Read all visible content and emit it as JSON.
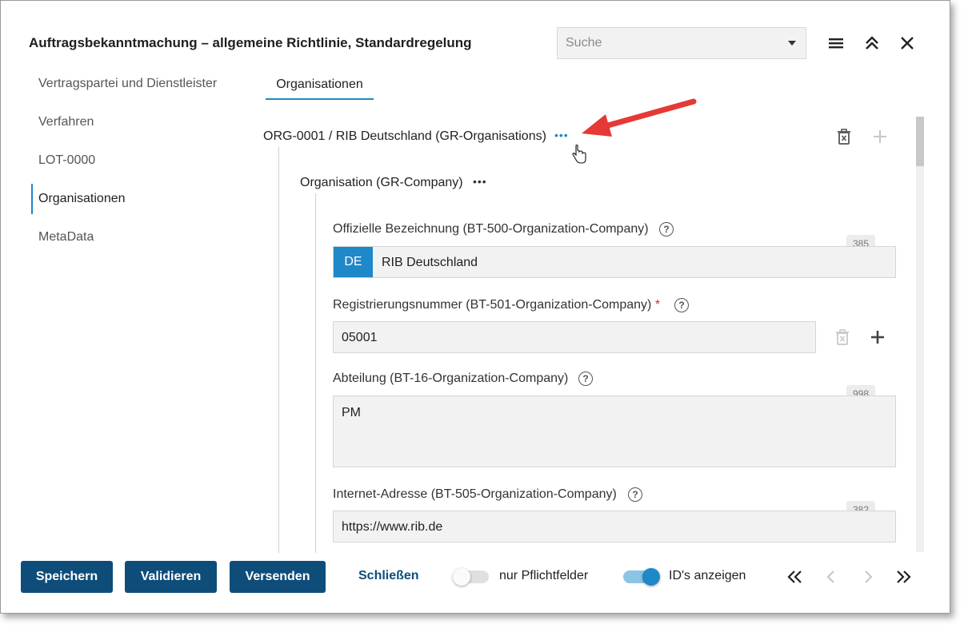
{
  "header": {
    "title": "Auftragsbekanntmachung – allgemeine Richtlinie, Standardregelung",
    "search_placeholder": "Suche",
    "icons": [
      "menu-icon",
      "collapse-up-icon",
      "close-icon"
    ]
  },
  "nav": {
    "items": [
      {
        "label": "Vertragspartei und Dienstleister"
      },
      {
        "label": "Verfahren"
      },
      {
        "label": "LOT-0000"
      },
      {
        "label": "Organisationen",
        "active": true
      },
      {
        "label": "MetaData"
      }
    ]
  },
  "tab": {
    "label": "Organisationen"
  },
  "org_group": {
    "label": "ORG-0001 / RIB Deutschland (GR-Organisations)",
    "dots": "•••"
  },
  "company_group": {
    "label": "Organisation (GR-Company)",
    "dots": "•••"
  },
  "fields": {
    "official_name": {
      "label": "Offizielle Bezeichnung (BT-500-Organization-Company)",
      "counter": "385",
      "lang": "DE",
      "value": "RIB Deutschland"
    },
    "registration": {
      "label": "Registrierungsnummer (BT-501-Organization-Company)",
      "required_mark": "*",
      "value": "05001"
    },
    "department": {
      "label": "Abteilung (BT-16-Organization-Company)",
      "counter": "998",
      "value": "PM"
    },
    "internet": {
      "label": "Internet-Adresse (BT-505-Organization-Company)",
      "counter": "382",
      "value": "https://www.rib.de"
    }
  },
  "help_glyph": "?",
  "footer": {
    "save_label": "Speichern",
    "validate_label": "Validieren",
    "send_label": "Versenden",
    "close_label": "Schließen",
    "toggle_required": {
      "label": "nur Pflichtfelder",
      "on": false
    },
    "toggle_ids": {
      "label": "ID's anzeigen",
      "on": true
    }
  },
  "colors": {
    "accent": "#1e88c8",
    "button": "#0e4d7a",
    "arrow": "#e53935",
    "required": "#d32f2f"
  }
}
